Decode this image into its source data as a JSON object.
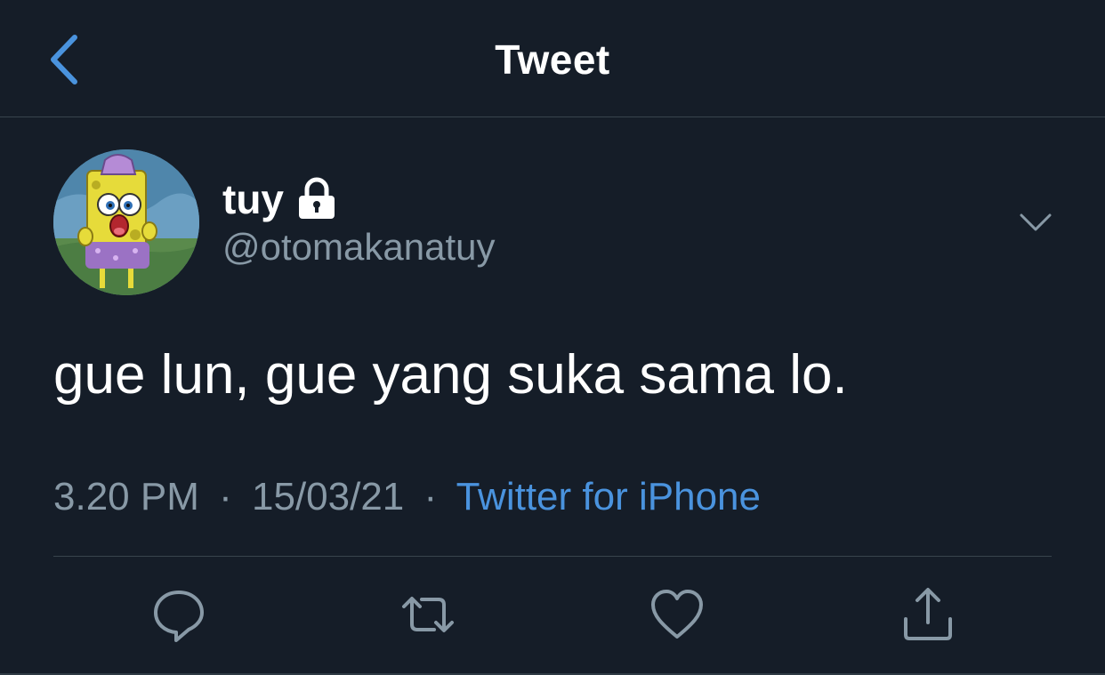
{
  "header": {
    "title": "Tweet",
    "back_icon": "chevron-left-icon"
  },
  "author": {
    "display_name": "tuy",
    "handle": "@otomakanatuy",
    "protected_icon": "lock-icon",
    "avatar_icon": "avatar-image"
  },
  "tweet": {
    "text": "gue lun, gue yang suka sama lo."
  },
  "meta": {
    "time": "3.20 PM",
    "separator": "·",
    "date": "15/03/21",
    "source": "Twitter for iPhone"
  },
  "actions": {
    "reply_icon": "reply-icon",
    "retweet_icon": "retweet-icon",
    "like_icon": "heart-icon",
    "share_icon": "share-icon"
  },
  "colors": {
    "background": "#151d28",
    "accent": "#4a93de",
    "secondary_text": "#8899a6",
    "divider": "#38444d"
  }
}
